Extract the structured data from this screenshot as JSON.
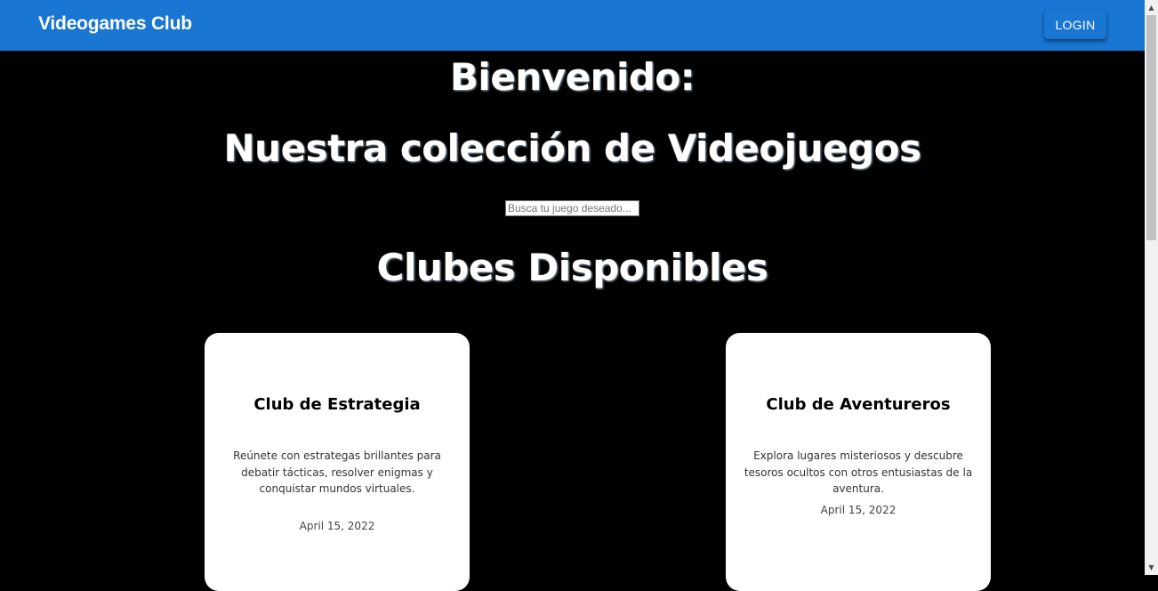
{
  "appbar": {
    "title": "Videogames Club",
    "login_label": "LOGIN",
    "color": "#1976d2"
  },
  "main": {
    "welcome": "Bienvenido:",
    "collection_title": "Nuestra colección de Videojuegos",
    "search": {
      "placeholder": "Busca tu juego deseado...",
      "value": ""
    },
    "clubs_title": "Clubes Disponibles",
    "clubs": [
      {
        "title": "Club de Estrategia",
        "description": "Reúnete con estrategas brillantes para debatir tácticas, resolver enigmas y conquistar mundos virtuales.",
        "date": "April 15, 2022"
      },
      {
        "title": "Club de Aventureros",
        "description": "Explora lugares misteriosos y descubre tesoros ocultos con otros entusiastas de la aventura.",
        "date": "April 15, 2022"
      }
    ]
  },
  "icons": {
    "scroll_up": "scroll-up-arrow-icon",
    "scroll_down": "scroll-down-arrow-icon"
  }
}
